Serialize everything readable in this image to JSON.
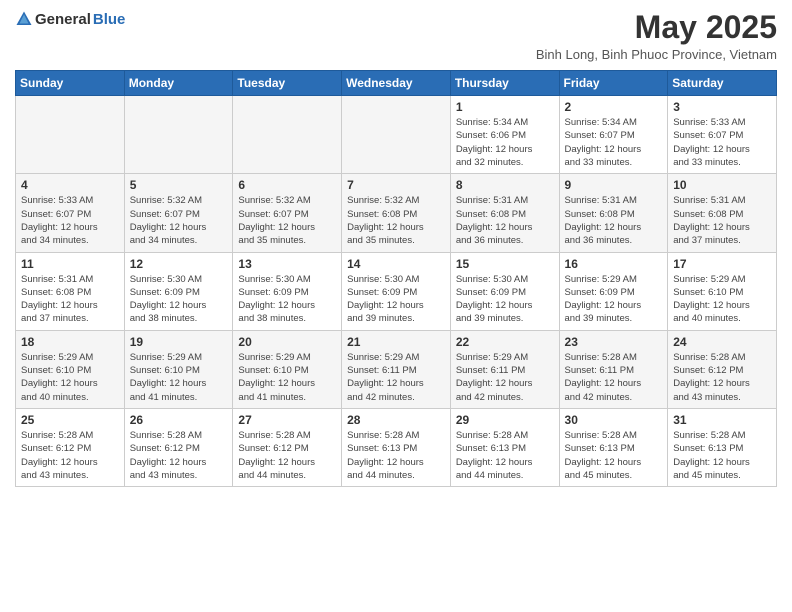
{
  "header": {
    "logo_general": "General",
    "logo_blue": "Blue",
    "title": "May 2025",
    "subtitle": "Binh Long, Binh Phuoc Province, Vietnam"
  },
  "calendar": {
    "days_of_week": [
      "Sunday",
      "Monday",
      "Tuesday",
      "Wednesday",
      "Thursday",
      "Friday",
      "Saturday"
    ],
    "weeks": [
      [
        {
          "day": "",
          "info": ""
        },
        {
          "day": "",
          "info": ""
        },
        {
          "day": "",
          "info": ""
        },
        {
          "day": "",
          "info": ""
        },
        {
          "day": "1",
          "info": "Sunrise: 5:34 AM\nSunset: 6:06 PM\nDaylight: 12 hours\nand 32 minutes."
        },
        {
          "day": "2",
          "info": "Sunrise: 5:34 AM\nSunset: 6:07 PM\nDaylight: 12 hours\nand 33 minutes."
        },
        {
          "day": "3",
          "info": "Sunrise: 5:33 AM\nSunset: 6:07 PM\nDaylight: 12 hours\nand 33 minutes."
        }
      ],
      [
        {
          "day": "4",
          "info": "Sunrise: 5:33 AM\nSunset: 6:07 PM\nDaylight: 12 hours\nand 34 minutes."
        },
        {
          "day": "5",
          "info": "Sunrise: 5:32 AM\nSunset: 6:07 PM\nDaylight: 12 hours\nand 34 minutes."
        },
        {
          "day": "6",
          "info": "Sunrise: 5:32 AM\nSunset: 6:07 PM\nDaylight: 12 hours\nand 35 minutes."
        },
        {
          "day": "7",
          "info": "Sunrise: 5:32 AM\nSunset: 6:08 PM\nDaylight: 12 hours\nand 35 minutes."
        },
        {
          "day": "8",
          "info": "Sunrise: 5:31 AM\nSunset: 6:08 PM\nDaylight: 12 hours\nand 36 minutes."
        },
        {
          "day": "9",
          "info": "Sunrise: 5:31 AM\nSunset: 6:08 PM\nDaylight: 12 hours\nand 36 minutes."
        },
        {
          "day": "10",
          "info": "Sunrise: 5:31 AM\nSunset: 6:08 PM\nDaylight: 12 hours\nand 37 minutes."
        }
      ],
      [
        {
          "day": "11",
          "info": "Sunrise: 5:31 AM\nSunset: 6:08 PM\nDaylight: 12 hours\nand 37 minutes."
        },
        {
          "day": "12",
          "info": "Sunrise: 5:30 AM\nSunset: 6:09 PM\nDaylight: 12 hours\nand 38 minutes."
        },
        {
          "day": "13",
          "info": "Sunrise: 5:30 AM\nSunset: 6:09 PM\nDaylight: 12 hours\nand 38 minutes."
        },
        {
          "day": "14",
          "info": "Sunrise: 5:30 AM\nSunset: 6:09 PM\nDaylight: 12 hours\nand 39 minutes."
        },
        {
          "day": "15",
          "info": "Sunrise: 5:30 AM\nSunset: 6:09 PM\nDaylight: 12 hours\nand 39 minutes."
        },
        {
          "day": "16",
          "info": "Sunrise: 5:29 AM\nSunset: 6:09 PM\nDaylight: 12 hours\nand 39 minutes."
        },
        {
          "day": "17",
          "info": "Sunrise: 5:29 AM\nSunset: 6:10 PM\nDaylight: 12 hours\nand 40 minutes."
        }
      ],
      [
        {
          "day": "18",
          "info": "Sunrise: 5:29 AM\nSunset: 6:10 PM\nDaylight: 12 hours\nand 40 minutes."
        },
        {
          "day": "19",
          "info": "Sunrise: 5:29 AM\nSunset: 6:10 PM\nDaylight: 12 hours\nand 41 minutes."
        },
        {
          "day": "20",
          "info": "Sunrise: 5:29 AM\nSunset: 6:10 PM\nDaylight: 12 hours\nand 41 minutes."
        },
        {
          "day": "21",
          "info": "Sunrise: 5:29 AM\nSunset: 6:11 PM\nDaylight: 12 hours\nand 42 minutes."
        },
        {
          "day": "22",
          "info": "Sunrise: 5:29 AM\nSunset: 6:11 PM\nDaylight: 12 hours\nand 42 minutes."
        },
        {
          "day": "23",
          "info": "Sunrise: 5:28 AM\nSunset: 6:11 PM\nDaylight: 12 hours\nand 42 minutes."
        },
        {
          "day": "24",
          "info": "Sunrise: 5:28 AM\nSunset: 6:12 PM\nDaylight: 12 hours\nand 43 minutes."
        }
      ],
      [
        {
          "day": "25",
          "info": "Sunrise: 5:28 AM\nSunset: 6:12 PM\nDaylight: 12 hours\nand 43 minutes."
        },
        {
          "day": "26",
          "info": "Sunrise: 5:28 AM\nSunset: 6:12 PM\nDaylight: 12 hours\nand 43 minutes."
        },
        {
          "day": "27",
          "info": "Sunrise: 5:28 AM\nSunset: 6:12 PM\nDaylight: 12 hours\nand 44 minutes."
        },
        {
          "day": "28",
          "info": "Sunrise: 5:28 AM\nSunset: 6:13 PM\nDaylight: 12 hours\nand 44 minutes."
        },
        {
          "day": "29",
          "info": "Sunrise: 5:28 AM\nSunset: 6:13 PM\nDaylight: 12 hours\nand 44 minutes."
        },
        {
          "day": "30",
          "info": "Sunrise: 5:28 AM\nSunset: 6:13 PM\nDaylight: 12 hours\nand 45 minutes."
        },
        {
          "day": "31",
          "info": "Sunrise: 5:28 AM\nSunset: 6:13 PM\nDaylight: 12 hours\nand 45 minutes."
        }
      ]
    ]
  }
}
